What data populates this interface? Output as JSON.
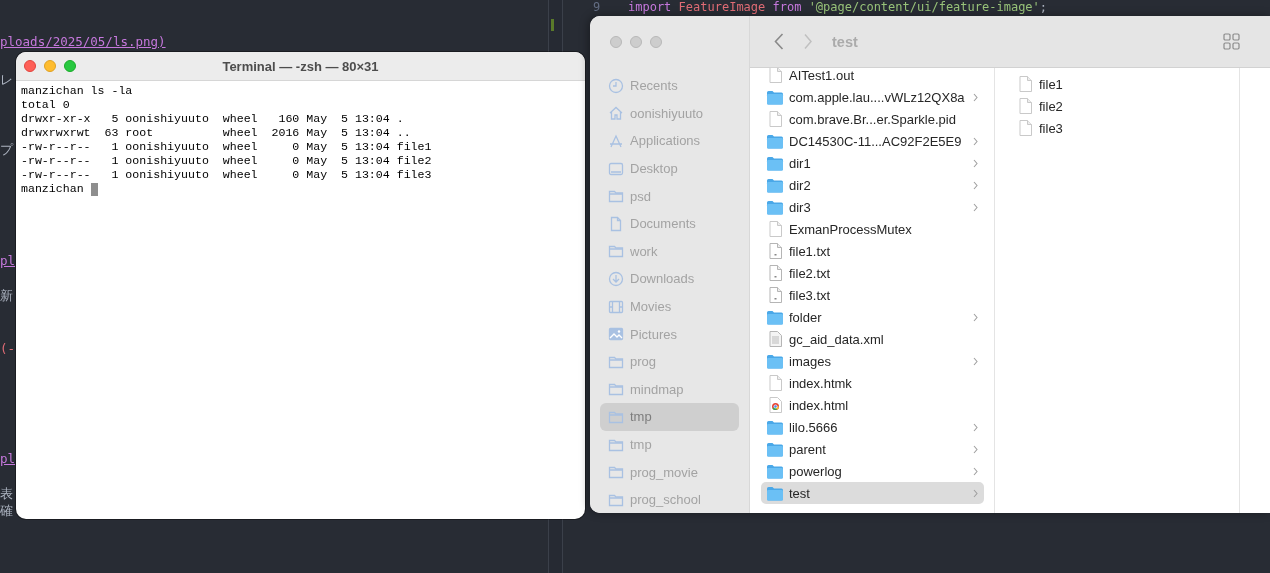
{
  "editor_left": {
    "lines": [
      {
        "text": "ploads/2025/05/ls.png)",
        "kind": "link"
      },
      {
        "text": "レ",
        "kind": "plain"
      },
      {
        "text": "プ",
        "kind": "plain"
      },
      {
        "text": "pl",
        "kind": "link"
      },
      {
        "text": "新",
        "kind": "plain"
      },
      {
        "text": "(-",
        "kind": "accent"
      },
      {
        "text": "pl",
        "kind": "link"
      },
      {
        "text": "表",
        "kind": "plain"
      },
      {
        "text": "確",
        "kind": "plain"
      }
    ]
  },
  "editor_right": {
    "line_number": "9",
    "code": [
      {
        "text": "import ",
        "kind": "keyword"
      },
      {
        "text": "FeatureImage ",
        "kind": "name"
      },
      {
        "text": "from ",
        "kind": "keyword"
      },
      {
        "text": "'@page/content/ui/feature-image'",
        "kind": "string"
      },
      {
        "text": ";",
        "kind": "plain"
      }
    ]
  },
  "terminal": {
    "title": "Terminal — -zsh — 80×31",
    "active": true,
    "lines": [
      "manzichan ls -la",
      "total 0",
      "drwxr-xr-x   5 oonishiyuuto  wheel   160 May  5 13:04 .",
      "drwxrwxrwt  63 root          wheel  2016 May  5 13:04 ..",
      "-rw-r--r--   1 oonishiyuuto  wheel     0 May  5 13:04 file1",
      "-rw-r--r--   1 oonishiyuuto  wheel     0 May  5 13:04 file2",
      "-rw-r--r--   1 oonishiyuuto  wheel     0 May  5 13:04 file3",
      "manzichan "
    ]
  },
  "finder": {
    "title": "test",
    "active": false,
    "sidebar": [
      {
        "label": "Recents",
        "kind": "recents",
        "selected": false
      },
      {
        "label": "oonishiyuuto",
        "kind": "home",
        "selected": false
      },
      {
        "label": "Applications",
        "kind": "apps",
        "selected": false
      },
      {
        "label": "Desktop",
        "kind": "desktop",
        "selected": false
      },
      {
        "label": "psd",
        "kind": "folder",
        "selected": false
      },
      {
        "label": "Documents",
        "kind": "document",
        "selected": false
      },
      {
        "label": "work",
        "kind": "folder",
        "selected": false
      },
      {
        "label": "Downloads",
        "kind": "downloads",
        "selected": false
      },
      {
        "label": "Movies",
        "kind": "movies",
        "selected": false
      },
      {
        "label": "Pictures",
        "kind": "pictures",
        "selected": false
      },
      {
        "label": "prog",
        "kind": "folder",
        "selected": false
      },
      {
        "label": "mindmap",
        "kind": "folder",
        "selected": false
      },
      {
        "label": "tmp",
        "kind": "folder",
        "selected": true
      },
      {
        "label": "tmp",
        "kind": "folder",
        "selected": false
      },
      {
        "label": "prog_movie",
        "kind": "folder",
        "selected": false
      },
      {
        "label": "prog_school",
        "kind": "folder",
        "selected": false
      }
    ],
    "column_1": [
      {
        "name": "AITest1.out",
        "kind": "file",
        "selected": false
      },
      {
        "name": "com.apple.lau....vWLz12QX8a",
        "kind": "folder",
        "selected": false
      },
      {
        "name": "com.brave.Br...er.Sparkle.pid",
        "kind": "file",
        "selected": false
      },
      {
        "name": "DC14530C-11...AC92F2E5E9",
        "kind": "folder",
        "selected": false
      },
      {
        "name": "dir1",
        "kind": "folder",
        "selected": false
      },
      {
        "name": "dir2",
        "kind": "folder",
        "selected": false
      },
      {
        "name": "dir3",
        "kind": "folder",
        "selected": false
      },
      {
        "name": "ExmanProcessMutex",
        "kind": "file",
        "selected": false
      },
      {
        "name": "file1.txt",
        "kind": "text",
        "selected": false
      },
      {
        "name": "file2.txt",
        "kind": "text",
        "selected": false
      },
      {
        "name": "file3.txt",
        "kind": "text",
        "selected": false
      },
      {
        "name": "folder",
        "kind": "folder",
        "selected": false
      },
      {
        "name": "gc_aid_data.xml",
        "kind": "xml",
        "selected": false
      },
      {
        "name": "images",
        "kind": "folder",
        "selected": false
      },
      {
        "name": "index.htmk",
        "kind": "file",
        "selected": false
      },
      {
        "name": "index.html",
        "kind": "web",
        "selected": false
      },
      {
        "name": "lilo.5666",
        "kind": "folder",
        "selected": false
      },
      {
        "name": "parent",
        "kind": "folder",
        "selected": false
      },
      {
        "name": "powerlog",
        "kind": "folder",
        "selected": false
      },
      {
        "name": "test",
        "kind": "folder",
        "selected": true
      }
    ],
    "column_2": [
      {
        "name": "file1",
        "kind": "file",
        "selected": false
      },
      {
        "name": "file2",
        "kind": "file",
        "selected": false
      },
      {
        "name": "file3",
        "kind": "file",
        "selected": false
      }
    ]
  }
}
